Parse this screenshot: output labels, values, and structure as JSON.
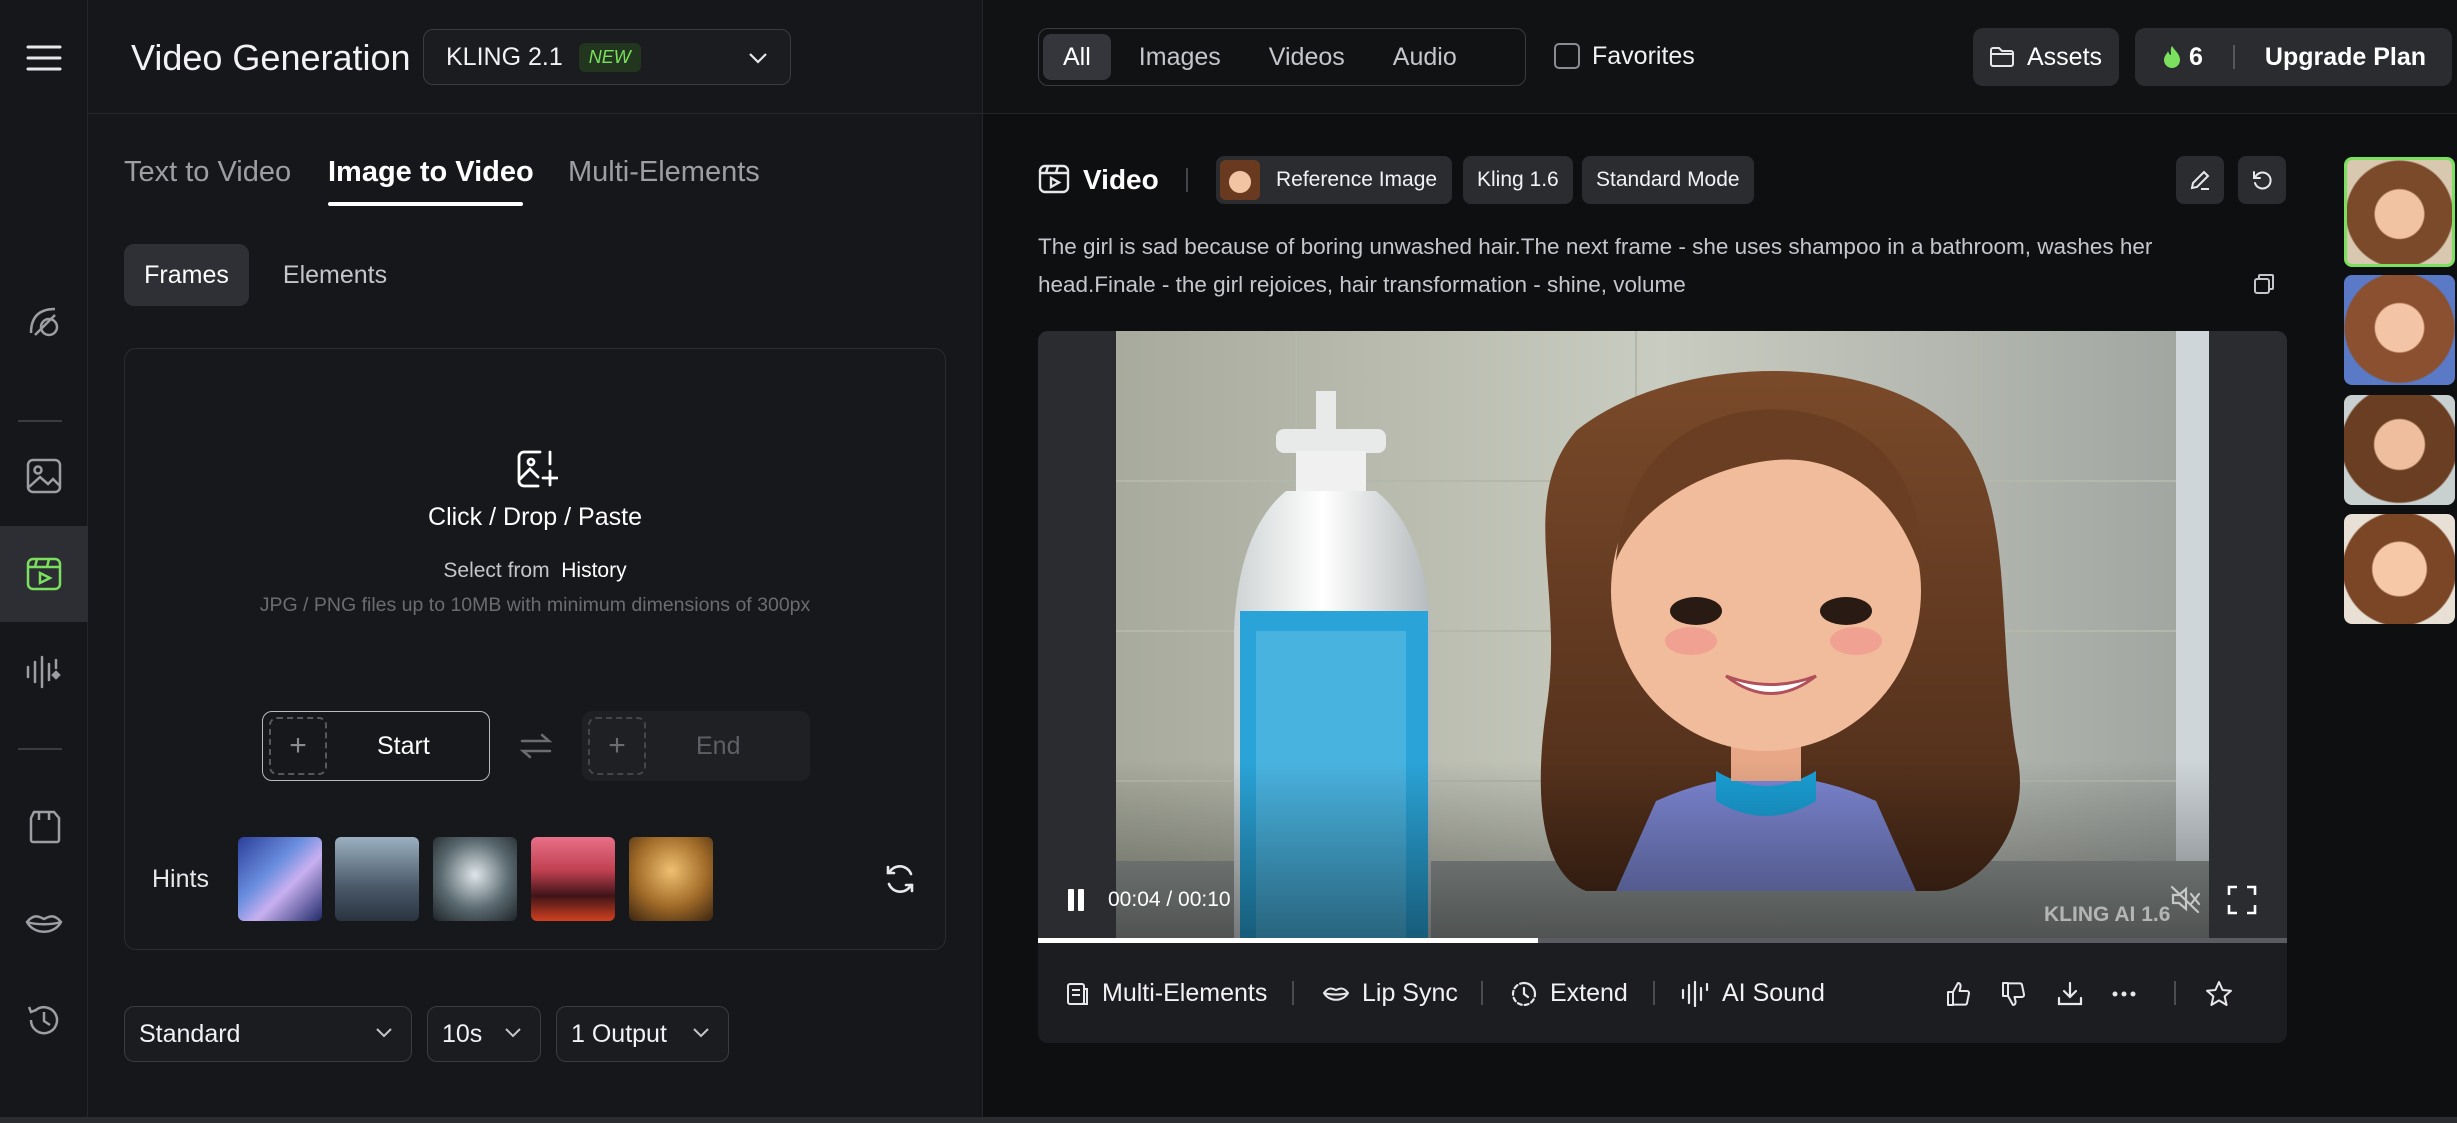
{
  "header": {
    "title": "Video Generation",
    "model": {
      "name": "KLING 2.1",
      "badge": "NEW"
    }
  },
  "mode_tabs": [
    "Text to Video",
    "Image to Video",
    "Multi-Elements"
  ],
  "sub_tabs": [
    "Frames",
    "Elements"
  ],
  "upload": {
    "title": "Click / Drop / Paste",
    "select_from": "Select from",
    "history": "History",
    "requirements": "JPG / PNG files up to 10MB with minimum dimensions of 300px"
  },
  "frames": {
    "start": "Start",
    "end": "End"
  },
  "hints": {
    "label": "Hints"
  },
  "settings": {
    "quality": "Standard",
    "duration": "10s",
    "outputs": "1 Output"
  },
  "filters": {
    "tabs": [
      "All",
      "Images",
      "Videos",
      "Audio"
    ],
    "favorites": "Favorites"
  },
  "top_actions": {
    "assets": "Assets",
    "credits": "6",
    "upgrade": "Upgrade Plan"
  },
  "result": {
    "type_label": "Video",
    "chips": [
      "Reference Image",
      "Kling 1.6",
      "Standard Mode"
    ],
    "prompt": "The girl is sad because of boring unwashed hair.The next frame - she uses shampoo in a bathroom, washes her head.Finale - the girl rejoices, hair transformation - shine, volume",
    "time": "00:04 / 00:10",
    "progress": 0.4,
    "watermark": "KLING AI 1.6",
    "actions": [
      "Multi-Elements",
      "Lip Sync",
      "Extend",
      "AI Sound"
    ]
  },
  "colors": {
    "accent_green": "#7be05e",
    "bg": "#0e0f11",
    "panel": "#16171a"
  }
}
